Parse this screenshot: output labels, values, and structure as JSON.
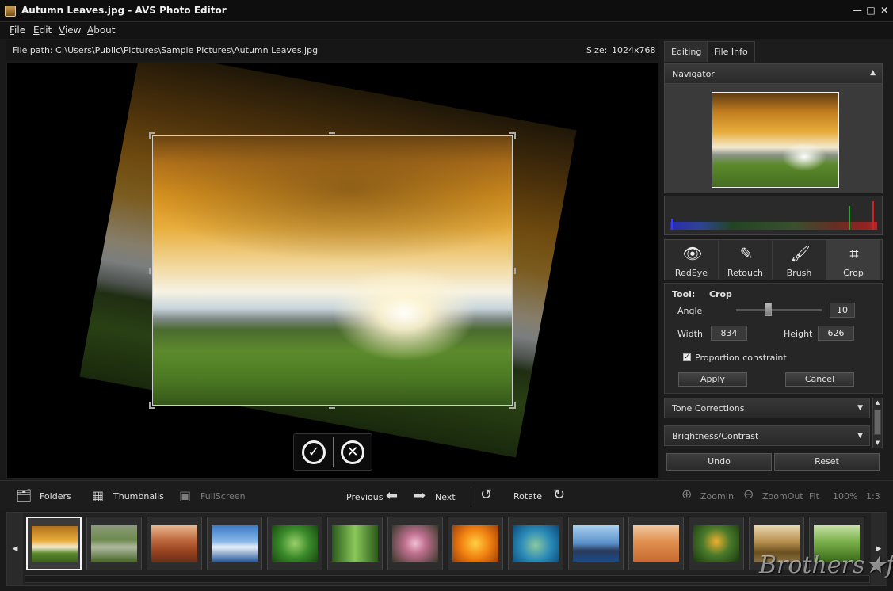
{
  "window": {
    "title": "Autumn Leaves.jpg   -  AVS Photo Editor",
    "controls": {
      "minimize": "—",
      "maximize": "□",
      "close": "✕"
    }
  },
  "menu": [
    "File",
    "Edit",
    "View",
    "About"
  ],
  "pathbar": {
    "path_label": "File path:",
    "path_value": "C:\\Users\\Public\\Pictures\\Sample Pictures\\Autumn Leaves.jpg",
    "size_label": "Size:",
    "size_value": "1024x768"
  },
  "tabs": [
    {
      "label": "Editing",
      "active": true
    },
    {
      "label": "File Info",
      "active": false
    }
  ],
  "navigator": {
    "label": "Navigator"
  },
  "tools": [
    {
      "label": "RedEye",
      "icon": "eye-icon"
    },
    {
      "label": "Retouch",
      "icon": "retouch-icon"
    },
    {
      "label": "Brush",
      "icon": "brush-icon"
    },
    {
      "label": "Crop",
      "icon": "crop-icon",
      "active": true
    }
  ],
  "tool_props": {
    "tool_label": "Tool:",
    "tool_value": "Crop",
    "angle_label": "Angle",
    "angle_value": "10",
    "width_label": "Width",
    "width_value": "834",
    "height_label": "Height",
    "height_value": "626",
    "proportion_label": "Proportion constraint",
    "proportion_checked": true,
    "apply_label": "Apply",
    "cancel_label": "Cancel"
  },
  "sections": {
    "tone_corrections": "Tone Corrections",
    "brightness_contrast": "Brightness/Contrast"
  },
  "history": {
    "undo_label": "Undo",
    "reset_label": "Reset"
  },
  "toolbar": {
    "folders": "Folders",
    "thumbnails": "Thumbnails",
    "fullscreen": "FullScreen",
    "previous": "Previous",
    "next": "Next",
    "rotate": "Rotate",
    "zoom_in": "ZoomIn",
    "zoom_out": "ZoomOut",
    "fit": "Fit",
    "zoom_level": "100%",
    "ratio": "1:3"
  },
  "watermark": "Brothers★ft"
}
